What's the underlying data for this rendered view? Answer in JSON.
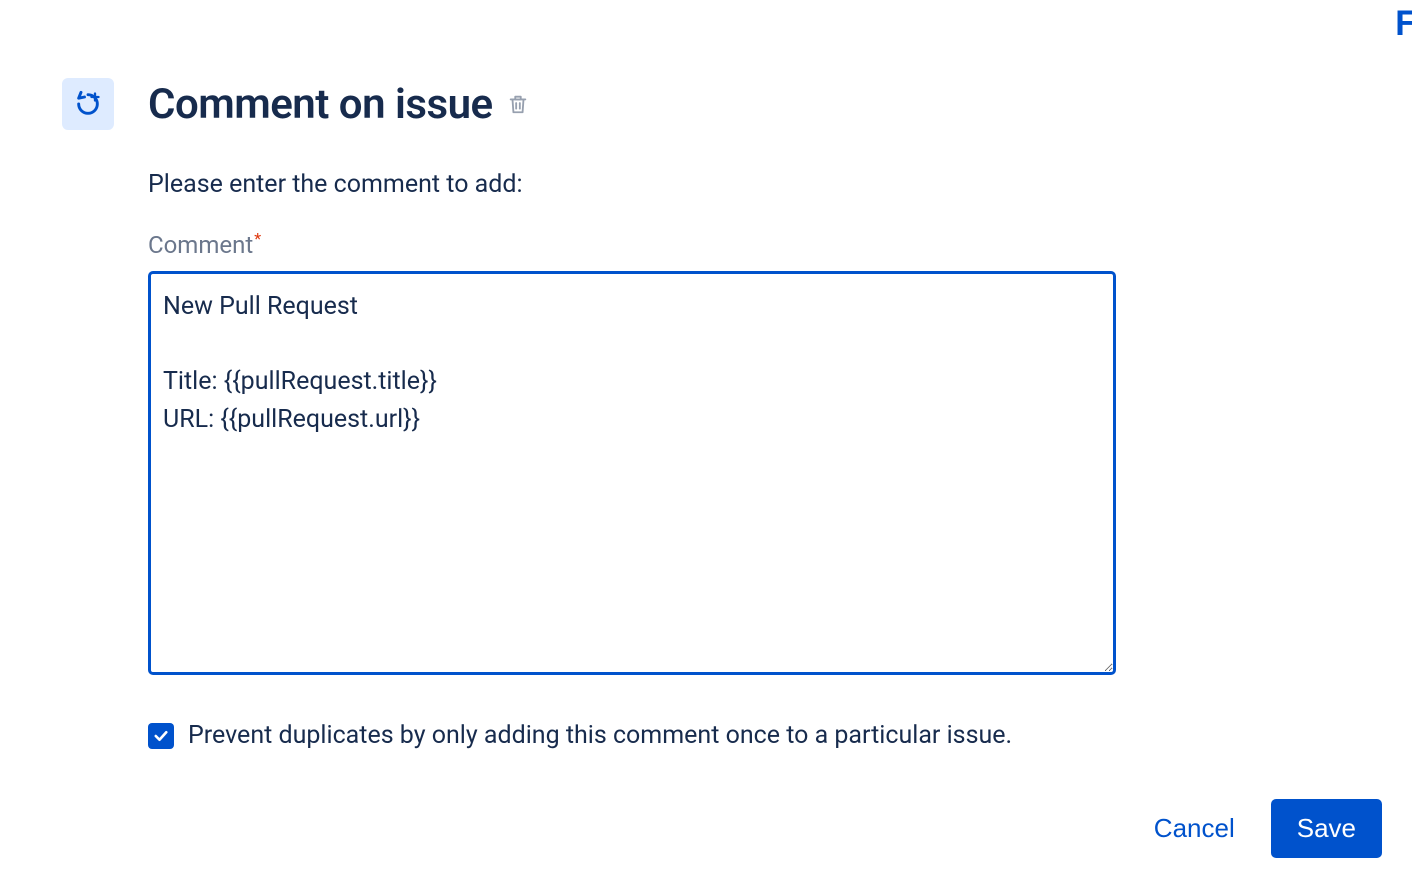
{
  "header": {
    "title": "Comment on issue"
  },
  "form": {
    "instruction": "Please enter the comment to add:",
    "field_label": "Comment",
    "comment_value": "New Pull Request\n\nTitle: {{pullRequest.title}}\nURL: {{pullRequest.url}}",
    "checkbox_label": "Prevent duplicates by only adding this comment once to a particular issue.",
    "checkbox_checked": true
  },
  "buttons": {
    "cancel_label": "Cancel",
    "save_label": "Save"
  },
  "edge_letter": "F"
}
